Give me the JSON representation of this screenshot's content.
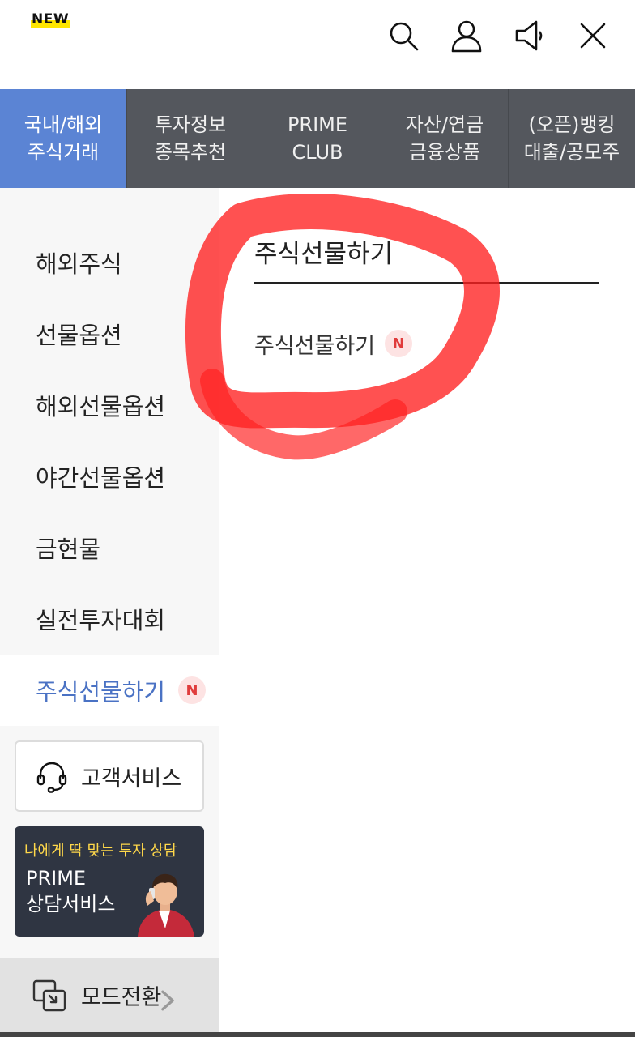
{
  "header": {
    "new_label": "NEW",
    "icons": [
      "search-icon",
      "user-icon",
      "megaphone-icon",
      "close-icon"
    ]
  },
  "tabs": [
    {
      "line1": "국내/해외",
      "line2": "주식거래",
      "active": true
    },
    {
      "line1": "투자정보",
      "line2": "종목추천",
      "active": false
    },
    {
      "line1": "PRIME",
      "line2": "CLUB",
      "active": false
    },
    {
      "line1": "자산/연금",
      "line2": "금융상품",
      "active": false
    },
    {
      "line1": "(오픈)뱅킹",
      "line2": "대출/공모주",
      "active": false
    }
  ],
  "left_menu": {
    "items": [
      {
        "label": "해외주식"
      },
      {
        "label": "선물옵션"
      },
      {
        "label": "해외선물옵션"
      },
      {
        "label": "야간선물옵션"
      },
      {
        "label": "금현물"
      },
      {
        "label": "실전투자대회"
      },
      {
        "label": "주식선물하기",
        "badge": "N",
        "active": true
      }
    ],
    "customer_service": "고객서비스",
    "prime_banner": {
      "tagline": "나에게 딱 맞는 투자 상담",
      "title_line1": "PRIME",
      "title_line2": "상담서비스"
    },
    "mode_switch": "모드전환"
  },
  "content": {
    "section_title": "주식선물하기",
    "items": [
      {
        "label": "주식선물하기",
        "badge": "N"
      }
    ]
  },
  "colors": {
    "active_tab": "#5b84d4",
    "tab_bg": "#54575d",
    "active_menu_text": "#4a72c4",
    "badge_text": "#e03c3c",
    "badge_bg": "#fde3e3",
    "annotation_red": "#ff2020",
    "new_highlight": "#ffe600"
  }
}
